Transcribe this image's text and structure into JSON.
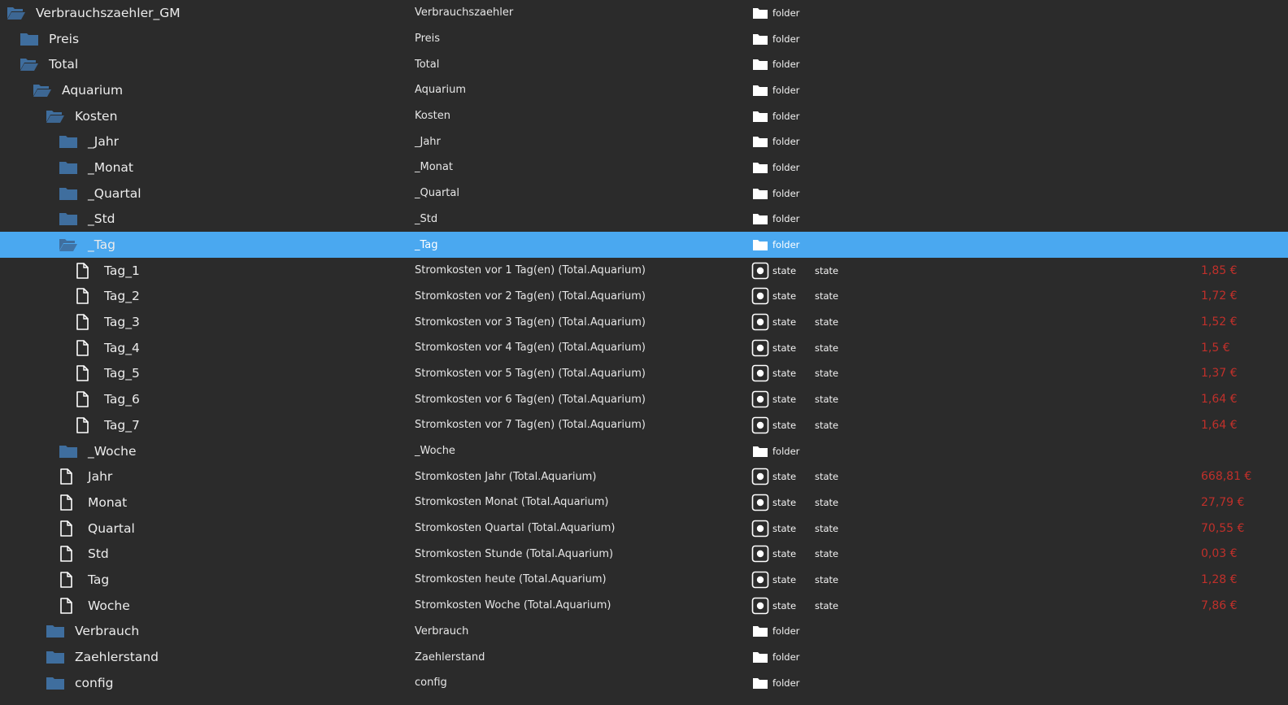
{
  "colors": {
    "background": "#2b2b2b",
    "selection": "#4aa8f0",
    "folder_icon": "#3f6e9e",
    "value_text": "#c0302b"
  },
  "rows": [
    {
      "name": "Verbrauchszaehler_GM",
      "depth": 0,
      "icon": "folder-open-icon",
      "desc": "Verbrauchszaehler",
      "type": "folder",
      "type_icon": "folder-icon"
    },
    {
      "name": "Preis",
      "depth": 1,
      "icon": "folder-icon",
      "desc": "Preis",
      "type": "folder",
      "type_icon": "folder-icon"
    },
    {
      "name": "Total",
      "depth": 1,
      "icon": "folder-open-icon",
      "desc": "Total",
      "type": "folder",
      "type_icon": "folder-icon"
    },
    {
      "name": "Aquarium",
      "depth": 2,
      "icon": "folder-open-icon",
      "desc": "Aquarium",
      "type": "folder",
      "type_icon": "folder-icon"
    },
    {
      "name": "Kosten",
      "depth": 3,
      "icon": "folder-open-icon",
      "desc": "Kosten",
      "type": "folder",
      "type_icon": "folder-icon"
    },
    {
      "name": "_Jahr",
      "depth": 4,
      "icon": "folder-icon",
      "desc": "_Jahr",
      "type": "folder",
      "type_icon": "folder-icon"
    },
    {
      "name": "_Monat",
      "depth": 4,
      "icon": "folder-icon",
      "desc": "_Monat",
      "type": "folder",
      "type_icon": "folder-icon"
    },
    {
      "name": "_Quartal",
      "depth": 4,
      "icon": "folder-icon",
      "desc": "_Quartal",
      "type": "folder",
      "type_icon": "folder-icon"
    },
    {
      "name": "_Std",
      "depth": 4,
      "icon": "folder-icon",
      "desc": "_Std",
      "type": "folder",
      "type_icon": "folder-icon"
    },
    {
      "name": "_Tag",
      "depth": 4,
      "icon": "folder-open-icon",
      "desc": "_Tag",
      "type": "folder",
      "type_icon": "folder-icon",
      "selected": true
    },
    {
      "name": "Tag_1",
      "depth": 5,
      "icon": "file-icon",
      "desc": "Stromkosten vor 1 Tag(en) (Total.Aquarium)",
      "type": "state",
      "type_icon": "state-icon",
      "role": "state",
      "value": "1,85 €"
    },
    {
      "name": "Tag_2",
      "depth": 5,
      "icon": "file-icon",
      "desc": "Stromkosten vor 2 Tag(en) (Total.Aquarium)",
      "type": "state",
      "type_icon": "state-icon",
      "role": "state",
      "value": "1,72 €"
    },
    {
      "name": "Tag_3",
      "depth": 5,
      "icon": "file-icon",
      "desc": "Stromkosten vor 3 Tag(en) (Total.Aquarium)",
      "type": "state",
      "type_icon": "state-icon",
      "role": "state",
      "value": "1,52 €"
    },
    {
      "name": "Tag_4",
      "depth": 5,
      "icon": "file-icon",
      "desc": "Stromkosten vor 4 Tag(en) (Total.Aquarium)",
      "type": "state",
      "type_icon": "state-icon",
      "role": "state",
      "value": "1,5 €"
    },
    {
      "name": "Tag_5",
      "depth": 5,
      "icon": "file-icon",
      "desc": "Stromkosten vor 5 Tag(en) (Total.Aquarium)",
      "type": "state",
      "type_icon": "state-icon",
      "role": "state",
      "value": "1,37 €"
    },
    {
      "name": "Tag_6",
      "depth": 5,
      "icon": "file-icon",
      "desc": "Stromkosten vor 6 Tag(en) (Total.Aquarium)",
      "type": "state",
      "type_icon": "state-icon",
      "role": "state",
      "value": "1,64 €"
    },
    {
      "name": "Tag_7",
      "depth": 5,
      "icon": "file-icon",
      "desc": "Stromkosten vor 7 Tag(en) (Total.Aquarium)",
      "type": "state",
      "type_icon": "state-icon",
      "role": "state",
      "value": "1,64 €"
    },
    {
      "name": "_Woche",
      "depth": 4,
      "icon": "folder-icon",
      "desc": "_Woche",
      "type": "folder",
      "type_icon": "folder-icon"
    },
    {
      "name": "Jahr",
      "depth": 4,
      "icon": "file-icon",
      "desc": "Stromkosten Jahr (Total.Aquarium)",
      "type": "state",
      "type_icon": "state-icon",
      "role": "state",
      "value": "668,81 €"
    },
    {
      "name": "Monat",
      "depth": 4,
      "icon": "file-icon",
      "desc": "Stromkosten Monat (Total.Aquarium)",
      "type": "state",
      "type_icon": "state-icon",
      "role": "state",
      "value": "27,79 €"
    },
    {
      "name": "Quartal",
      "depth": 4,
      "icon": "file-icon",
      "desc": "Stromkosten Quartal (Total.Aquarium)",
      "type": "state",
      "type_icon": "state-icon",
      "role": "state",
      "value": "70,55 €"
    },
    {
      "name": "Std",
      "depth": 4,
      "icon": "file-icon",
      "desc": "Stromkosten Stunde (Total.Aquarium)",
      "type": "state",
      "type_icon": "state-icon",
      "role": "state",
      "value": "0,03 €"
    },
    {
      "name": "Tag",
      "depth": 4,
      "icon": "file-icon",
      "desc": "Stromkosten heute (Total.Aquarium)",
      "type": "state",
      "type_icon": "state-icon",
      "role": "state",
      "value": "1,28 €"
    },
    {
      "name": "Woche",
      "depth": 4,
      "icon": "file-icon",
      "desc": "Stromkosten Woche (Total.Aquarium)",
      "type": "state",
      "type_icon": "state-icon",
      "role": "state",
      "value": "7,86 €"
    },
    {
      "name": "Verbrauch",
      "depth": 3,
      "icon": "folder-icon",
      "desc": "Verbrauch",
      "type": "folder",
      "type_icon": "folder-icon"
    },
    {
      "name": "Zaehlerstand",
      "depth": 3,
      "icon": "folder-icon",
      "desc": "Zaehlerstand",
      "type": "folder",
      "type_icon": "folder-icon"
    },
    {
      "name": "config",
      "depth": 3,
      "icon": "folder-icon",
      "desc": "config",
      "type": "folder",
      "type_icon": "folder-icon"
    }
  ]
}
